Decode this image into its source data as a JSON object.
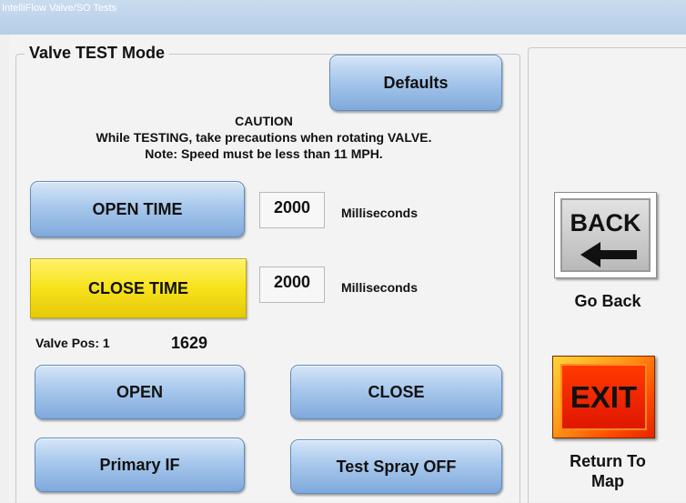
{
  "window": {
    "title": "IntelliFlow Valve/SO Tests"
  },
  "group": {
    "title": "Valve TEST Mode"
  },
  "buttons": {
    "defaults": "Defaults",
    "open_time": "OPEN TIME",
    "close_time": "CLOSE TIME",
    "open": "OPEN",
    "close": "CLOSE",
    "primary_if": "Primary IF",
    "test_spray": "Test Spray OFF"
  },
  "caution": {
    "heading": "CAUTION",
    "line1": "While TESTING, take precautions when rotating VALVE.",
    "line2": "Note: Speed must be less than 11 MPH."
  },
  "open_time": {
    "value": "2000",
    "unit": "Milliseconds"
  },
  "close_time": {
    "value": "2000",
    "unit": "Milliseconds"
  },
  "valve_pos": {
    "label": "Valve Pos: 1",
    "value": "1629"
  },
  "back": {
    "label": "BACK",
    "caption": "Go Back",
    "icon": "left-arrow-icon"
  },
  "exit": {
    "label": "EXIT",
    "caption_line1": "Return To",
    "caption_line2": "Map"
  },
  "colors": {
    "button_blue": "#a8c8ec",
    "close_time_yellow": "#f7e21a",
    "exit_red": "#e01600",
    "exit_orange": "#ff9a16"
  }
}
